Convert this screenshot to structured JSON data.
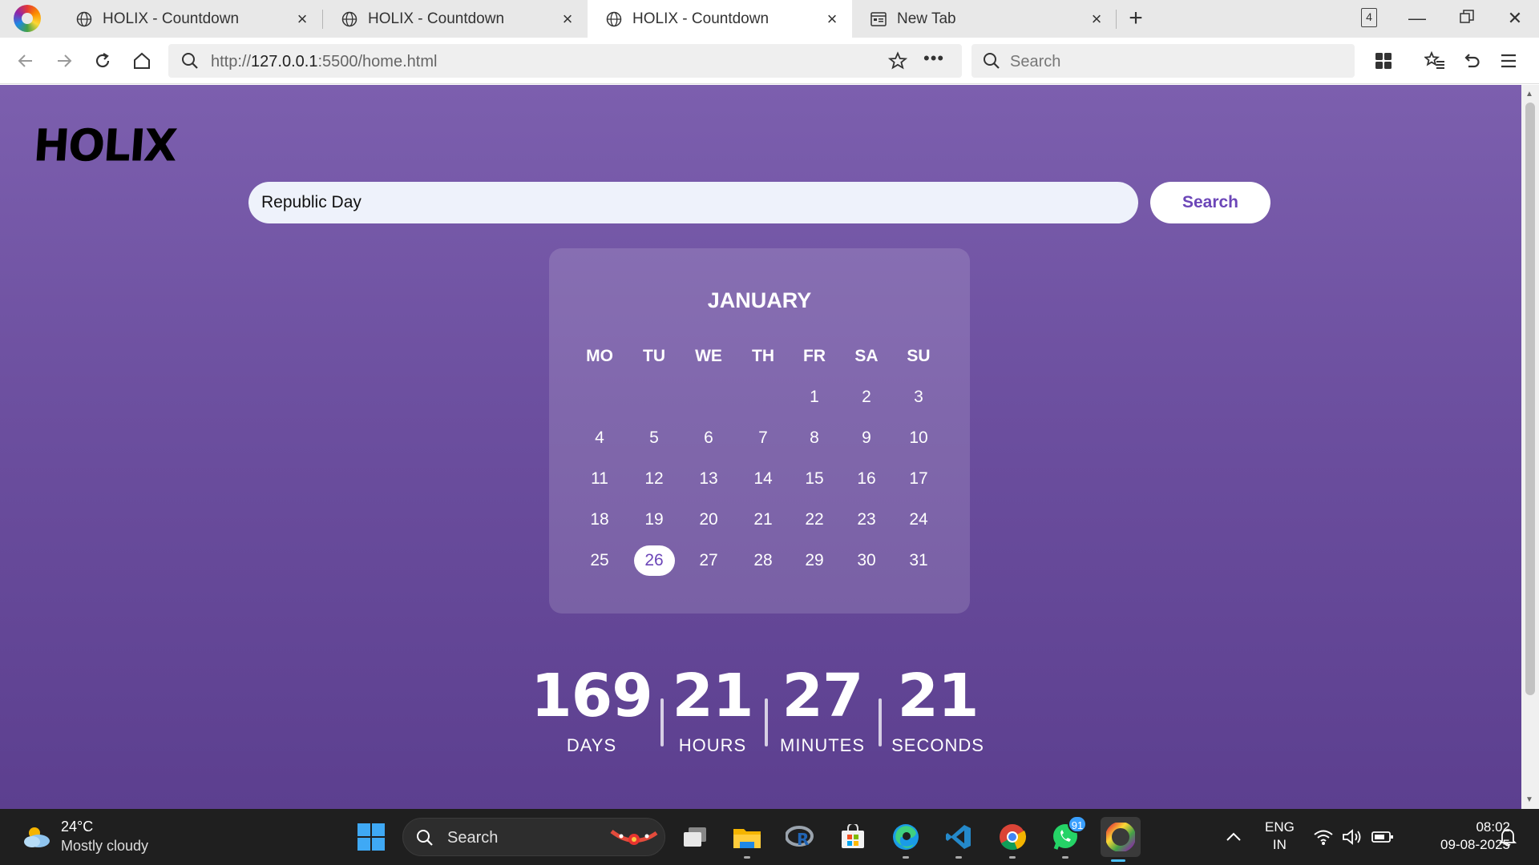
{
  "browser": {
    "tabs": [
      {
        "title": "HOLIX - Countdown",
        "active": false
      },
      {
        "title": "HOLIX - Countdown",
        "active": false
      },
      {
        "title": "HOLIX - Countdown",
        "active": true
      },
      {
        "title": "New Tab",
        "active": false
      }
    ],
    "tab_count": "4",
    "url_prefix": "http://",
    "url_host": "127.0.0.1",
    "url_rest": ":5500/home.html",
    "search_placeholder": "Search"
  },
  "page": {
    "logo": "HOLIX",
    "search_value": "Republic Day",
    "search_button": "Search",
    "calendar": {
      "month": "JANUARY",
      "weekdays": [
        "MO",
        "TU",
        "WE",
        "TH",
        "FR",
        "SA",
        "SU"
      ],
      "first_weekday_index": 4,
      "days_in_month": 31,
      "highlighted_day": 26
    },
    "countdown": [
      {
        "value": "169",
        "label": "DAYS"
      },
      {
        "value": "21",
        "label": "HOURS"
      },
      {
        "value": "27",
        "label": "MINUTES"
      },
      {
        "value": "21",
        "label": "SECONDS"
      }
    ]
  },
  "taskbar": {
    "weather_temp": "24°C",
    "weather_desc": "Mostly cloudy",
    "search_placeholder": "Search",
    "whatsapp_badge": "91",
    "language": "ENG",
    "region": "IN",
    "time": "08:02",
    "date": "09-08-2025"
  },
  "colors": {
    "accent": "#6c46b8",
    "page_top": "#7c5fae",
    "page_bottom": "#5c3f8f"
  }
}
